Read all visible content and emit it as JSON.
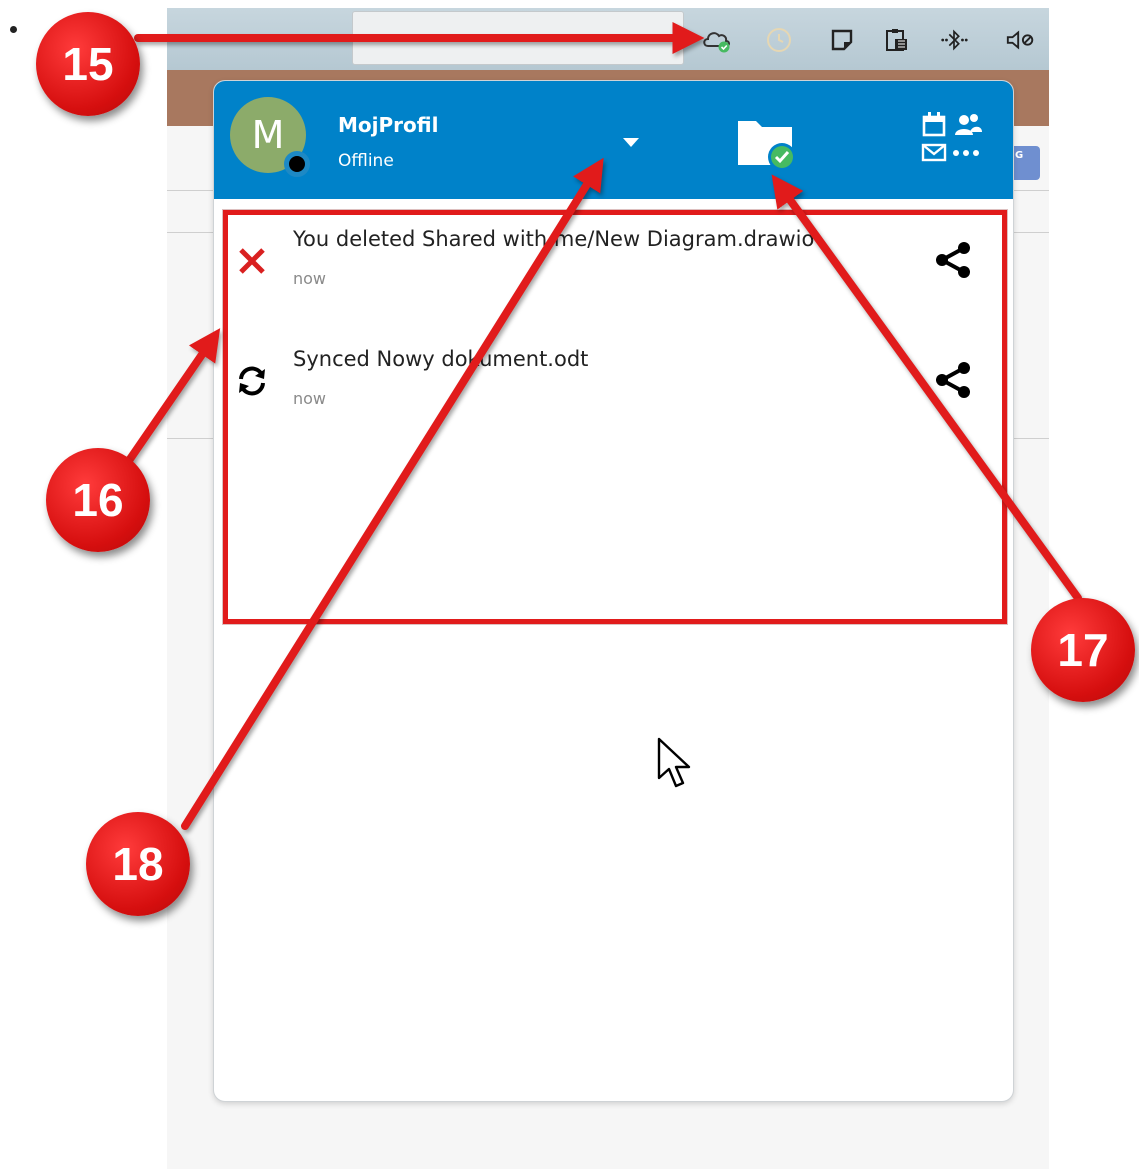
{
  "profile": {
    "name": "MojProfil",
    "status": "Offline",
    "avatar_letter": "M"
  },
  "activities": [
    {
      "type": "deleted",
      "icon": "delete-x-icon",
      "title": "You deleted Shared with me/New Diagram.drawio",
      "time": "now"
    },
    {
      "type": "synced",
      "icon": "sync-icon",
      "title": "Synced Nowy dokument.odt",
      "time": "now"
    }
  ],
  "annotations": {
    "callouts": [
      "15",
      "16",
      "17",
      "18"
    ]
  },
  "tray_icons": [
    "cloud-sync-icon",
    "clock-icon",
    "sticky-note-icon",
    "clipboard-icon",
    "bluetooth-icon",
    "volume-muted-icon"
  ],
  "colors": {
    "header": "#0082c9",
    "annotation_red": "#e11b1b",
    "delete_red": "#d92020",
    "sync_ok_green": "#46ba61",
    "avatar_green": "#8cab6a"
  }
}
